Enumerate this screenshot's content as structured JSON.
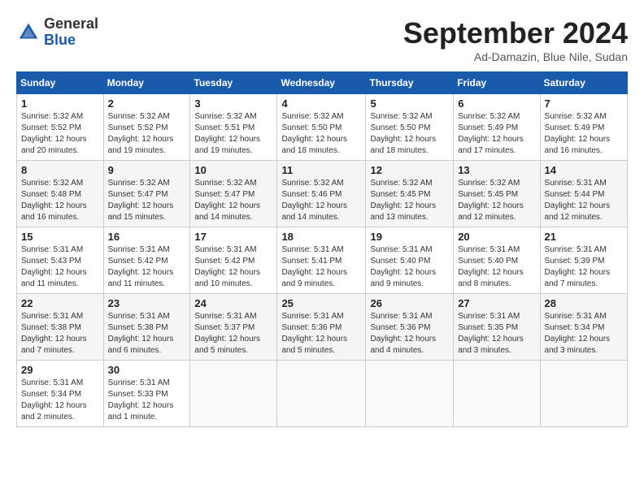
{
  "header": {
    "logo_general": "General",
    "logo_blue": "Blue",
    "month_title": "September 2024",
    "location": "Ad-Damazin, Blue Nile, Sudan"
  },
  "weekdays": [
    "Sunday",
    "Monday",
    "Tuesday",
    "Wednesday",
    "Thursday",
    "Friday",
    "Saturday"
  ],
  "weeks": [
    [
      {
        "day": "1",
        "detail": "Sunrise: 5:32 AM\nSunset: 5:52 PM\nDaylight: 12 hours\nand 20 minutes."
      },
      {
        "day": "2",
        "detail": "Sunrise: 5:32 AM\nSunset: 5:52 PM\nDaylight: 12 hours\nand 19 minutes."
      },
      {
        "day": "3",
        "detail": "Sunrise: 5:32 AM\nSunset: 5:51 PM\nDaylight: 12 hours\nand 19 minutes."
      },
      {
        "day": "4",
        "detail": "Sunrise: 5:32 AM\nSunset: 5:50 PM\nDaylight: 12 hours\nand 18 minutes."
      },
      {
        "day": "5",
        "detail": "Sunrise: 5:32 AM\nSunset: 5:50 PM\nDaylight: 12 hours\nand 18 minutes."
      },
      {
        "day": "6",
        "detail": "Sunrise: 5:32 AM\nSunset: 5:49 PM\nDaylight: 12 hours\nand 17 minutes."
      },
      {
        "day": "7",
        "detail": "Sunrise: 5:32 AM\nSunset: 5:49 PM\nDaylight: 12 hours\nand 16 minutes."
      }
    ],
    [
      {
        "day": "8",
        "detail": "Sunrise: 5:32 AM\nSunset: 5:48 PM\nDaylight: 12 hours\nand 16 minutes."
      },
      {
        "day": "9",
        "detail": "Sunrise: 5:32 AM\nSunset: 5:47 PM\nDaylight: 12 hours\nand 15 minutes."
      },
      {
        "day": "10",
        "detail": "Sunrise: 5:32 AM\nSunset: 5:47 PM\nDaylight: 12 hours\nand 14 minutes."
      },
      {
        "day": "11",
        "detail": "Sunrise: 5:32 AM\nSunset: 5:46 PM\nDaylight: 12 hours\nand 14 minutes."
      },
      {
        "day": "12",
        "detail": "Sunrise: 5:32 AM\nSunset: 5:45 PM\nDaylight: 12 hours\nand 13 minutes."
      },
      {
        "day": "13",
        "detail": "Sunrise: 5:32 AM\nSunset: 5:45 PM\nDaylight: 12 hours\nand 12 minutes."
      },
      {
        "day": "14",
        "detail": "Sunrise: 5:31 AM\nSunset: 5:44 PM\nDaylight: 12 hours\nand 12 minutes."
      }
    ],
    [
      {
        "day": "15",
        "detail": "Sunrise: 5:31 AM\nSunset: 5:43 PM\nDaylight: 12 hours\nand 11 minutes."
      },
      {
        "day": "16",
        "detail": "Sunrise: 5:31 AM\nSunset: 5:42 PM\nDaylight: 12 hours\nand 11 minutes."
      },
      {
        "day": "17",
        "detail": "Sunrise: 5:31 AM\nSunset: 5:42 PM\nDaylight: 12 hours\nand 10 minutes."
      },
      {
        "day": "18",
        "detail": "Sunrise: 5:31 AM\nSunset: 5:41 PM\nDaylight: 12 hours\nand 9 minutes."
      },
      {
        "day": "19",
        "detail": "Sunrise: 5:31 AM\nSunset: 5:40 PM\nDaylight: 12 hours\nand 9 minutes."
      },
      {
        "day": "20",
        "detail": "Sunrise: 5:31 AM\nSunset: 5:40 PM\nDaylight: 12 hours\nand 8 minutes."
      },
      {
        "day": "21",
        "detail": "Sunrise: 5:31 AM\nSunset: 5:39 PM\nDaylight: 12 hours\nand 7 minutes."
      }
    ],
    [
      {
        "day": "22",
        "detail": "Sunrise: 5:31 AM\nSunset: 5:38 PM\nDaylight: 12 hours\nand 7 minutes."
      },
      {
        "day": "23",
        "detail": "Sunrise: 5:31 AM\nSunset: 5:38 PM\nDaylight: 12 hours\nand 6 minutes."
      },
      {
        "day": "24",
        "detail": "Sunrise: 5:31 AM\nSunset: 5:37 PM\nDaylight: 12 hours\nand 5 minutes."
      },
      {
        "day": "25",
        "detail": "Sunrise: 5:31 AM\nSunset: 5:36 PM\nDaylight: 12 hours\nand 5 minutes."
      },
      {
        "day": "26",
        "detail": "Sunrise: 5:31 AM\nSunset: 5:36 PM\nDaylight: 12 hours\nand 4 minutes."
      },
      {
        "day": "27",
        "detail": "Sunrise: 5:31 AM\nSunset: 5:35 PM\nDaylight: 12 hours\nand 3 minutes."
      },
      {
        "day": "28",
        "detail": "Sunrise: 5:31 AM\nSunset: 5:34 PM\nDaylight: 12 hours\nand 3 minutes."
      }
    ],
    [
      {
        "day": "29",
        "detail": "Sunrise: 5:31 AM\nSunset: 5:34 PM\nDaylight: 12 hours\nand 2 minutes."
      },
      {
        "day": "30",
        "detail": "Sunrise: 5:31 AM\nSunset: 5:33 PM\nDaylight: 12 hours\nand 1 minute."
      },
      {
        "day": "",
        "detail": ""
      },
      {
        "day": "",
        "detail": ""
      },
      {
        "day": "",
        "detail": ""
      },
      {
        "day": "",
        "detail": ""
      },
      {
        "day": "",
        "detail": ""
      }
    ]
  ]
}
